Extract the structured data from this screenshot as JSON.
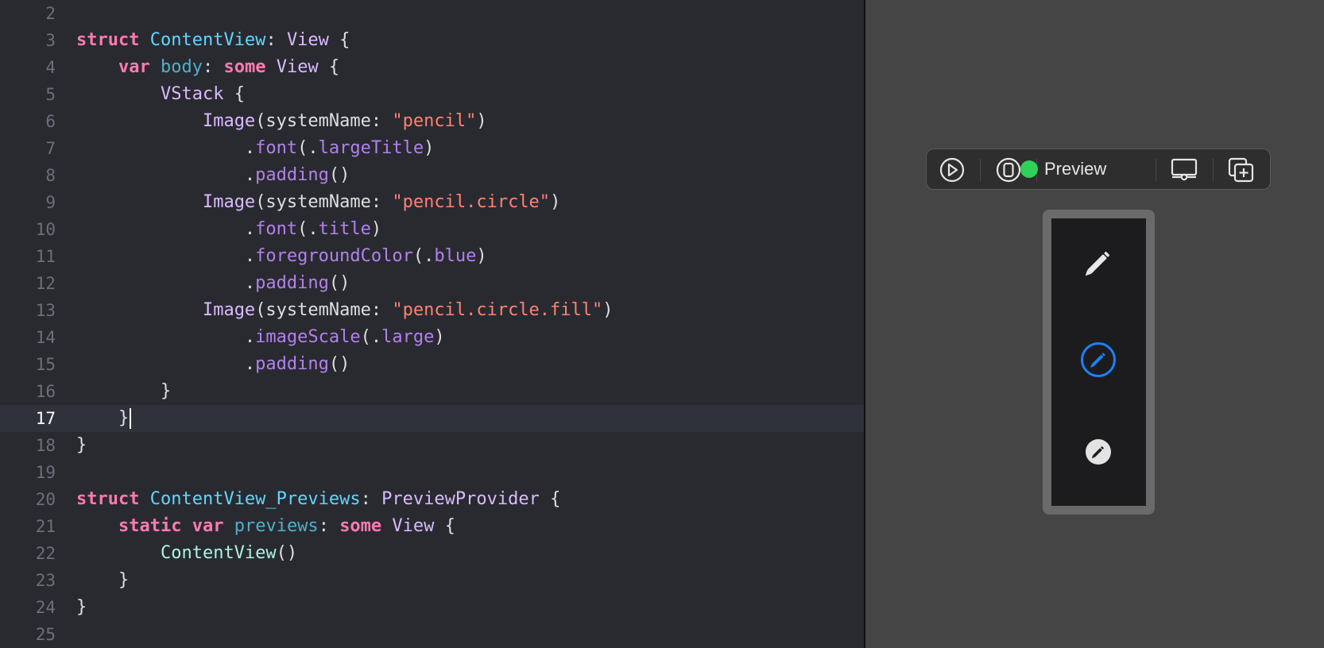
{
  "editor": {
    "current_line": "17",
    "lines": [
      {
        "n": "2"
      },
      {
        "n": "3",
        "t": [
          [
            "kw",
            "struct"
          ],
          [
            "",
            ""
          ],
          [
            "type",
            " ContentView"
          ],
          [
            "",
            ": "
          ],
          [
            "type2",
            "View"
          ],
          [
            "",
            " {"
          ]
        ]
      },
      {
        "n": "4",
        "t": [
          [
            "",
            "    "
          ],
          [
            "kw",
            "var"
          ],
          [
            "prop",
            " body"
          ],
          [
            "",
            ": "
          ],
          [
            "kw",
            "some"
          ],
          [
            "type2",
            " View"
          ],
          [
            "",
            " {"
          ]
        ]
      },
      {
        "n": "5",
        "t": [
          [
            "",
            "        "
          ],
          [
            "type2",
            "VStack"
          ],
          [
            "",
            " {"
          ]
        ]
      },
      {
        "n": "6",
        "t": [
          [
            "",
            "            "
          ],
          [
            "type2",
            "Image"
          ],
          [
            "",
            "(systemName: "
          ],
          [
            "str",
            "\"pencil\""
          ],
          [
            "",
            ")"
          ]
        ]
      },
      {
        "n": "7",
        "t": [
          [
            "",
            "                ."
          ],
          [
            "mem",
            "font"
          ],
          [
            "",
            "(."
          ],
          [
            "mem",
            "largeTitle"
          ],
          [
            "",
            ")"
          ]
        ]
      },
      {
        "n": "8",
        "t": [
          [
            "",
            "                ."
          ],
          [
            "mem",
            "padding"
          ],
          [
            "",
            "()"
          ]
        ]
      },
      {
        "n": "9",
        "t": [
          [
            "",
            "            "
          ],
          [
            "type2",
            "Image"
          ],
          [
            "",
            "(systemName: "
          ],
          [
            "str",
            "\"pencil.circle\""
          ],
          [
            "",
            ")"
          ]
        ]
      },
      {
        "n": "10",
        "t": [
          [
            "",
            "                ."
          ],
          [
            "mem",
            "font"
          ],
          [
            "",
            "(."
          ],
          [
            "mem",
            "title"
          ],
          [
            "",
            ")"
          ]
        ]
      },
      {
        "n": "11",
        "t": [
          [
            "",
            "                ."
          ],
          [
            "mem",
            "foregroundColor"
          ],
          [
            "",
            "(."
          ],
          [
            "mem",
            "blue"
          ],
          [
            "",
            ")"
          ]
        ]
      },
      {
        "n": "12",
        "t": [
          [
            "",
            "                ."
          ],
          [
            "mem",
            "padding"
          ],
          [
            "",
            "()"
          ]
        ]
      },
      {
        "n": "13",
        "t": [
          [
            "",
            "            "
          ],
          [
            "type2",
            "Image"
          ],
          [
            "",
            "(systemName: "
          ],
          [
            "str",
            "\"pencil.circle.fill\""
          ],
          [
            "",
            ")"
          ]
        ]
      },
      {
        "n": "14",
        "t": [
          [
            "",
            "                ."
          ],
          [
            "mem",
            "imageScale"
          ],
          [
            "",
            "(."
          ],
          [
            "mem",
            "large"
          ],
          [
            "",
            ")"
          ]
        ]
      },
      {
        "n": "15",
        "t": [
          [
            "",
            "                ."
          ],
          [
            "mem",
            "padding"
          ],
          [
            "",
            "()"
          ]
        ]
      },
      {
        "n": "16",
        "t": [
          [
            "",
            "        }"
          ]
        ]
      },
      {
        "n": "17",
        "t": [
          [
            "",
            "    }"
          ]
        ]
      },
      {
        "n": "18",
        "t": [
          [
            "",
            "}"
          ]
        ]
      },
      {
        "n": "19"
      },
      {
        "n": "20",
        "t": [
          [
            "kw",
            "struct"
          ],
          [
            "type",
            " ContentView_Previews"
          ],
          [
            "",
            ": "
          ],
          [
            "type2",
            "PreviewProvider"
          ],
          [
            "",
            " {"
          ]
        ]
      },
      {
        "n": "21",
        "t": [
          [
            "",
            "    "
          ],
          [
            "kw",
            "static"
          ],
          [
            "",
            " "
          ],
          [
            "kw",
            "var"
          ],
          [
            "prop",
            " previews"
          ],
          [
            "",
            ": "
          ],
          [
            "kw",
            "some"
          ],
          [
            "type2",
            " View"
          ],
          [
            "",
            " {"
          ]
        ]
      },
      {
        "n": "22",
        "t": [
          [
            "",
            "        "
          ],
          [
            "cls",
            "ContentView"
          ],
          [
            "",
            "()"
          ]
        ]
      },
      {
        "n": "23",
        "t": [
          [
            "",
            "    }"
          ]
        ]
      },
      {
        "n": "24",
        "t": [
          [
            "",
            "}"
          ]
        ]
      },
      {
        "n": "25"
      }
    ]
  },
  "preview": {
    "toolbar": {
      "live_icon": "play-circle-icon",
      "selectable_icon": "device-selectable-icon",
      "status_color": "#30d158",
      "label": "Preview",
      "device_settings_icon": "device-settings-icon",
      "duplicate_icon": "duplicate-preview-icon"
    },
    "symbols": [
      {
        "name": "pencil",
        "color": "#e8e8e8"
      },
      {
        "name": "pencil.circle",
        "color": "#1a82ff"
      },
      {
        "name": "pencil.circle.fill",
        "color": "#e3e3e3"
      }
    ]
  }
}
